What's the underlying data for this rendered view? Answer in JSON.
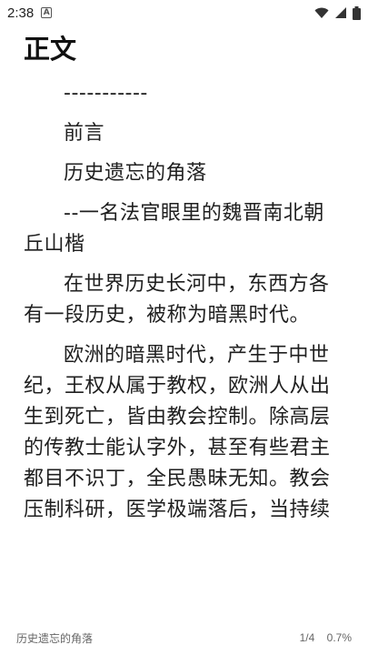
{
  "status_bar": {
    "time": "2:38",
    "notification_icon": "a-icon",
    "wifi_icon": "wifi-icon",
    "signal_icon": "signal-icon",
    "battery_icon": "battery-icon"
  },
  "reader": {
    "chapter_title": "正文",
    "paragraphs": [
      "-----------",
      "前言",
      "历史遗忘的角落",
      "--一名法官眼里的魏晋南北朝 丘山楷",
      "在世界历史长河中，东西方各有一段历史，被称为暗黑时代。",
      "欧洲的暗黑时代，产生于中世纪，王权从属于教权，欧洲人从出生到死亡，皆由教会控制。除高层的传教士能认字外，甚至有些君主都目不识丁，全民愚昧无知。教会压制科研，医学极端落后，当持续"
    ]
  },
  "footer": {
    "book_title": "历史遗忘的角落",
    "page": "1/4",
    "progress": "0.7%"
  }
}
